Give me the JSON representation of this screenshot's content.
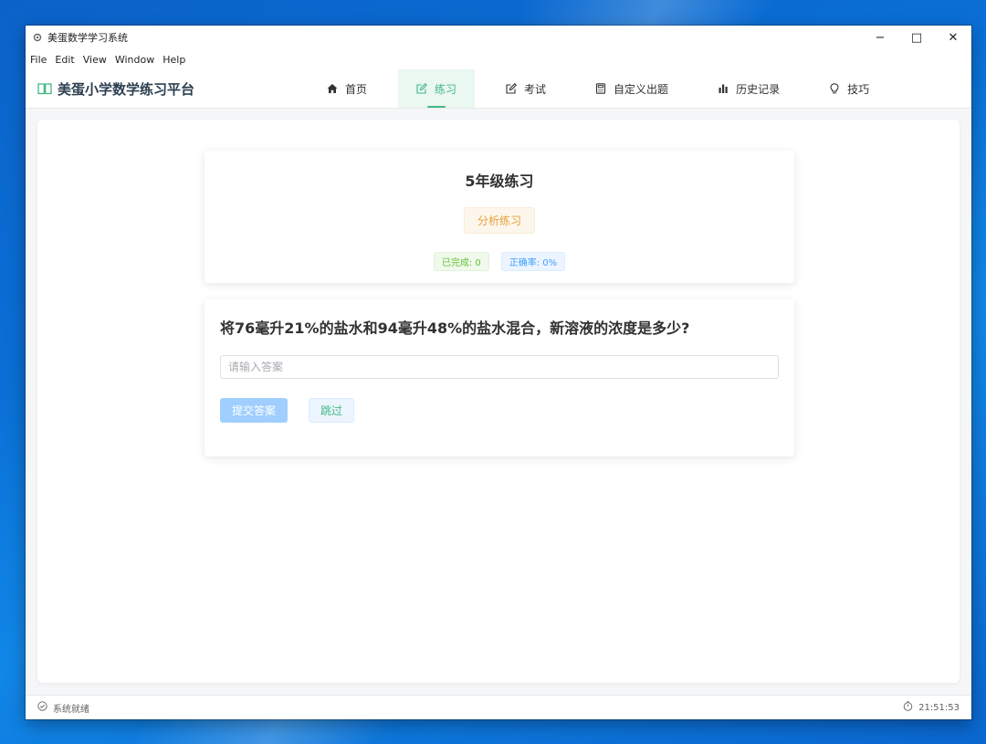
{
  "window": {
    "title": "美蛋数学学习系统",
    "controls": {
      "minimize": "−",
      "maximize": "□",
      "close": "✕"
    }
  },
  "menu": [
    "File",
    "Edit",
    "View",
    "Window",
    "Help"
  ],
  "brand": {
    "name": "美蛋小学数学练习平台",
    "icon": "book-icon"
  },
  "nav": {
    "tabs": [
      {
        "label": "首页",
        "icon": "home-icon"
      },
      {
        "label": "练习",
        "icon": "edit-icon",
        "active": true
      },
      {
        "label": "考试",
        "icon": "edit-icon"
      },
      {
        "label": "自定义出题",
        "icon": "calculator-icon"
      },
      {
        "label": "历史记录",
        "icon": "bar-chart-icon"
      },
      {
        "label": "技巧",
        "icon": "lightbulb-icon"
      }
    ]
  },
  "exercise": {
    "title": "5年级练习",
    "analyze_label": "分析练习",
    "completed": "已完成: 0",
    "accuracy": "正确率: 0%"
  },
  "question": {
    "text": "将76毫升21%的盐水和94毫升48%的盐水混合，新溶液的浓度是多少?",
    "input_placeholder": "请输入答案",
    "input_value": "",
    "submit_label": "提交答案",
    "skip_label": "跳过"
  },
  "status": {
    "text": "系统就绪",
    "time": "21:51:53"
  },
  "colors": {
    "accent": "#42b983",
    "warning": "#e6a23c",
    "primary_disabled": "#a0cfff",
    "info": "#409eff"
  }
}
